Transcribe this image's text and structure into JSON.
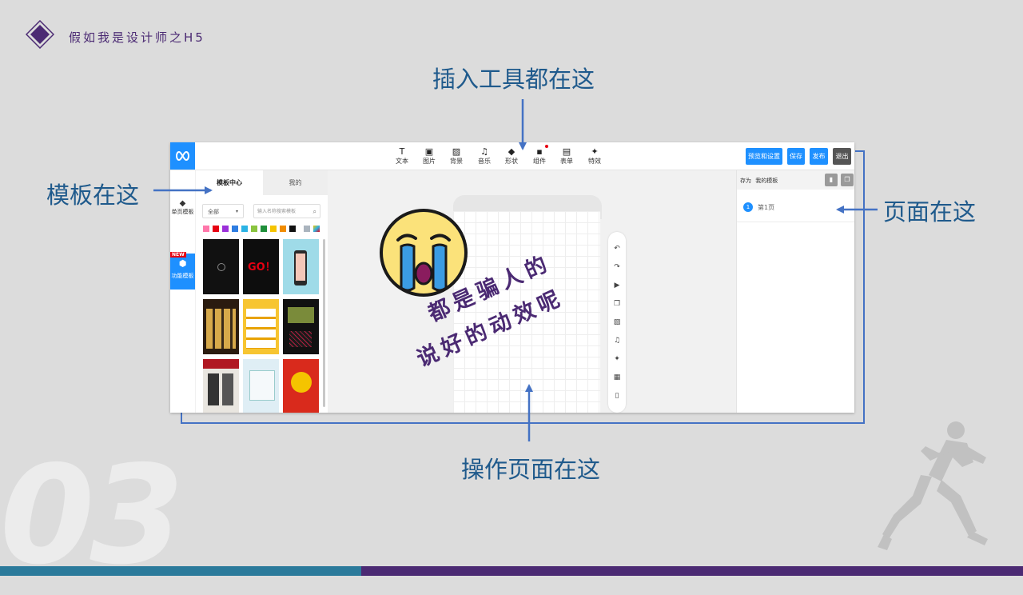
{
  "slide": {
    "title": "假如我是设计师之H5",
    "big_number": "03",
    "colors": {
      "accent_purple": "#4b2a73",
      "arrow_blue": "#4472c4",
      "bar_teal": "#2b7a9b",
      "callout_blue": "#1f5a8c"
    }
  },
  "callouts": {
    "top": "插入工具都在这",
    "left": "模板在这",
    "right": "页面在这",
    "bottom": "操作页面在这"
  },
  "overlay": {
    "line1": "都是骗人的",
    "line2": "说好的动效呢"
  },
  "editor": {
    "toolbar": [
      {
        "label": "文本",
        "icon": "text-icon",
        "glyph": "T"
      },
      {
        "label": "图片",
        "icon": "image-icon",
        "glyph": "▣"
      },
      {
        "label": "背景",
        "icon": "background-icon",
        "glyph": "▨"
      },
      {
        "label": "音乐",
        "icon": "music-icon",
        "glyph": "♫"
      },
      {
        "label": "形状",
        "icon": "shape-icon",
        "glyph": "◆"
      },
      {
        "label": "组件",
        "icon": "component-icon",
        "glyph": "▪"
      },
      {
        "label": "表单",
        "icon": "form-icon",
        "glyph": "▤"
      },
      {
        "label": "特效",
        "icon": "effect-icon",
        "glyph": "✦"
      }
    ],
    "buttons": {
      "preview": "预览和设置",
      "save": "保存",
      "publish": "发布",
      "exit": "退出"
    },
    "rail": {
      "single_page": "单页模板",
      "function": "功能模板",
      "new_badge": "NEW"
    },
    "panel": {
      "tab_center": "模板中心",
      "tab_mine": "我的",
      "filter_value": "全部",
      "search_placeholder": "输入名称搜索模板",
      "thumb_go": "GO！"
    },
    "right_panel": {
      "save_as": "存为",
      "my_templates": "我的模板",
      "page_number": "1",
      "page_name": "第1页"
    }
  }
}
